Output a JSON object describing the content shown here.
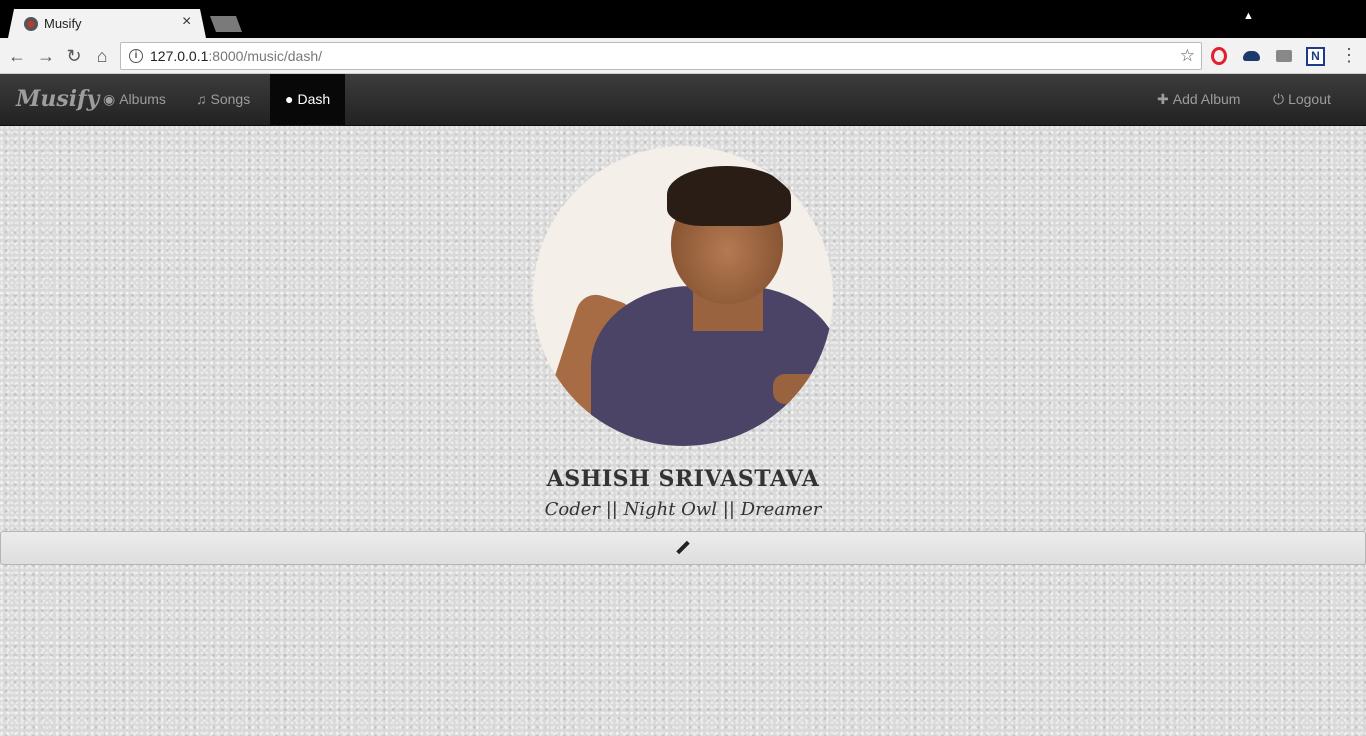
{
  "browser": {
    "tab_title": "Musify",
    "tab_close": "×",
    "url_host": "127.0.0.1",
    "url_rest": ":8000/music/dash/"
  },
  "navbar": {
    "brand": "Musify",
    "items": [
      {
        "label": "Albums",
        "icon": "globe-icon"
      },
      {
        "label": "Songs",
        "icon": "music-icon"
      },
      {
        "label": "Dash",
        "icon": "user-icon",
        "active": true
      }
    ],
    "right_items": [
      {
        "label": "Add Album",
        "icon": "plus-icon"
      },
      {
        "label": "Logout",
        "icon": "power-icon"
      }
    ]
  },
  "profile": {
    "name": "ASHISH SRIVASTAVA",
    "tagline": "Coder || Night Owl || Dreamer"
  },
  "colors": {
    "navbar_bg": "#222222",
    "active_nav_bg": "#080808",
    "nav_text": "#9d9d9d"
  }
}
